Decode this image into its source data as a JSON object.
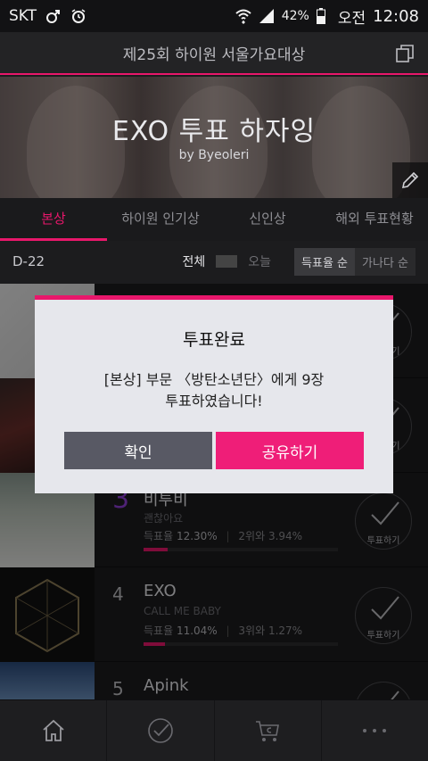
{
  "status_bar": {
    "carrier": "SKT",
    "battery": "42%",
    "ampm": "오전",
    "time": "12:08"
  },
  "app_bar": {
    "title": "제25회 하이원 서울가요대상"
  },
  "hero": {
    "title": "EXO 투표 하자잉",
    "subtitle": "by Byeoleri"
  },
  "tabs": [
    {
      "label": "본상",
      "active": true
    },
    {
      "label": "하이원 인기상",
      "active": false
    },
    {
      "label": "신인상",
      "active": false
    },
    {
      "label": "해외 투표현황",
      "active": false
    }
  ],
  "filters": {
    "dday": "D-22",
    "period": [
      "전체",
      "오늘"
    ],
    "sort": [
      "득표율 순",
      "가나다 순"
    ]
  },
  "list": [
    {
      "rank": "3",
      "artist": "비투비",
      "song": "괜찮아요",
      "rate_label": "득표율",
      "rate": "12.30%",
      "gap": "2위와 3.94%",
      "rate_value": 12.3,
      "vote_label": "투표하기"
    },
    {
      "rank": "4",
      "artist": "EXO",
      "song": "CALL ME BABY",
      "rate_label": "득표율",
      "rate": "11.04%",
      "gap": "3위와 1.27%",
      "rate_value": 11.04,
      "vote_label": "투표하기"
    },
    {
      "rank": "5",
      "artist": "Apink"
    }
  ],
  "behind_dialog": {
    "row1_vote_label": "투표하기",
    "row2_vote_label": "투표하기"
  },
  "dialog": {
    "title": "투표완료",
    "message_line1": "[본상] 부문 〈방탄소년단〉에게 9장",
    "message_line2": "투표하였습니다!",
    "ok_label": "확인",
    "share_label": "공유하기"
  },
  "colors": {
    "accent": "#e8176b",
    "rank_top": "#8e3fd6",
    "dialog_ok": "#585964",
    "dialog_share": "#ef1e78"
  }
}
